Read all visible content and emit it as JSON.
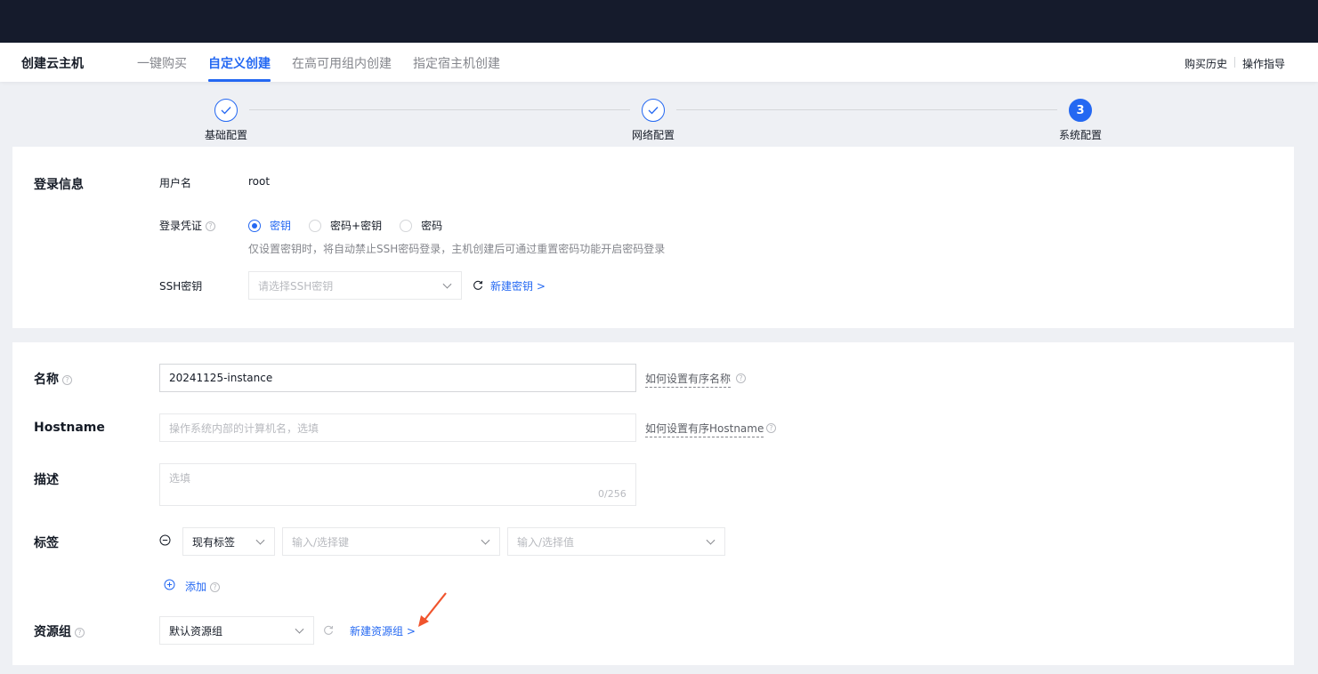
{
  "header": {
    "title": "创建云主机",
    "tabs": [
      {
        "label": "一键购买",
        "active": false
      },
      {
        "label": "自定义创建",
        "active": true
      },
      {
        "label": "在高可用组内创建",
        "active": false
      },
      {
        "label": "指定宿主机创建",
        "active": false
      }
    ],
    "links": {
      "history": "购买历史",
      "guide": "操作指导"
    }
  },
  "steps": [
    {
      "label": "基础配置",
      "status": "done"
    },
    {
      "label": "网络配置",
      "status": "done"
    },
    {
      "label": "系统配置",
      "status": "current",
      "number": "3"
    }
  ],
  "login": {
    "section_title": "登录信息",
    "username_label": "用户名",
    "username_value": "root",
    "credential_label": "登录凭证",
    "credential_options": [
      "密钥",
      "密码+密钥",
      "密码"
    ],
    "credential_selected": "密钥",
    "credential_hint": "仅设置密钥时，将自动禁止SSH密码登录，主机创建后可通过重置密码功能开启密码登录",
    "ssh_label": "SSH密钥",
    "ssh_placeholder": "请选择SSH密钥",
    "new_key_link": "新建密钥 >"
  },
  "instance": {
    "name_label": "名称",
    "name_value": "20241125-instance",
    "name_help": "如何设置有序名称",
    "hostname_label": "Hostname",
    "hostname_placeholder": "操作系统内部的计算机名，选填",
    "hostname_help": "如何设置有序Hostname",
    "desc_label": "描述",
    "desc_placeholder": "选填",
    "desc_counter": "0/256",
    "tag_label": "标签",
    "tag_type": "现有标签",
    "tag_key_placeholder": "输入/选择键",
    "tag_value_placeholder": "输入/选择值",
    "tag_add": "添加",
    "rg_label": "资源组",
    "rg_value": "默认资源组",
    "rg_new_link": "新建资源组 >"
  },
  "colors": {
    "accent": "#2468f2",
    "topbar": "#151b2c",
    "annotation_arrow": "#f0542d"
  }
}
